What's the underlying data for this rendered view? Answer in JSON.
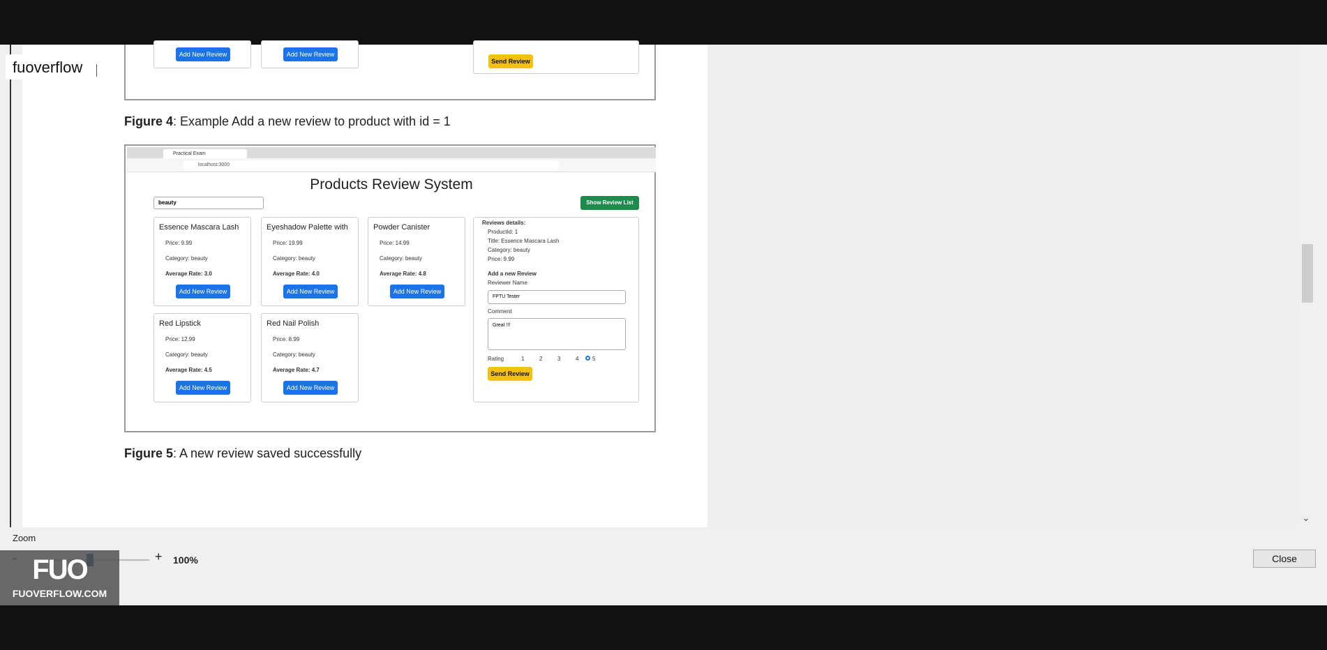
{
  "overlay_label": "fuoverflow",
  "figure4": {
    "bold": "Figure 4",
    "text": ": Example Add a new review to product with id = 1"
  },
  "figure5": {
    "bold": "Figure 5",
    "text": ": A new review saved successfully"
  },
  "top_shot": {
    "buttons": [
      "Add New Review",
      "Add New Review"
    ],
    "send_label": "Send Review"
  },
  "browser": {
    "tab": "Practical Exam",
    "url": "localhost:3000"
  },
  "app": {
    "title": "Products Review System",
    "select_value": "beauty",
    "show_list_label": "Show Review List",
    "products": [
      {
        "name": "Essence Mascara Lash",
        "price": "Price: 9.99",
        "category": "Category: beauty",
        "rate": "Average Rate: 3.0",
        "button": "Add New Review"
      },
      {
        "name": "Eyeshadow Palette with",
        "price": "Price: 19.99",
        "category": "Category: beauty",
        "rate": "Average Rate: 4.0",
        "button": "Add New Review"
      },
      {
        "name": "Powder Canister",
        "price": "Price: 14.99",
        "category": "Category: beauty",
        "rate": "Average Rate: 4.8",
        "button": "Add New Review"
      },
      {
        "name": "Red Lipstick",
        "price": "Price: 12.99",
        "category": "Category: beauty",
        "rate": "Average Rate: 4.5",
        "button": "Add New Review"
      },
      {
        "name": "Red Nail Polish",
        "price": "Price: 8.99",
        "category": "Category: beauty",
        "rate": "Average Rate: 4.7",
        "button": "Add New Review"
      }
    ],
    "details": {
      "heading": "Reviews details:",
      "product_id": "ProductId: 1",
      "title": "Title: Essence Mascara Lash",
      "category": "Category: beauty",
      "price": "Price: 9.99",
      "add_heading": "Add a new Review",
      "reviewer_label": "Reviewer Name",
      "reviewer_value": "FPTU Tester",
      "comment_label": "Comment",
      "comment_value": "Great !!!",
      "rating_label": "Rating",
      "ratings": [
        "1",
        "2",
        "3",
        "4",
        "5"
      ],
      "selected_rating": "5",
      "send_label": "Send Review"
    }
  },
  "zoom": {
    "label": "Zoom",
    "minus": "-",
    "plus": "+",
    "value": "100%"
  },
  "close_label": "Close",
  "watermark": {
    "big": "FUO",
    "small": "FUOVERFLOW.COM"
  }
}
